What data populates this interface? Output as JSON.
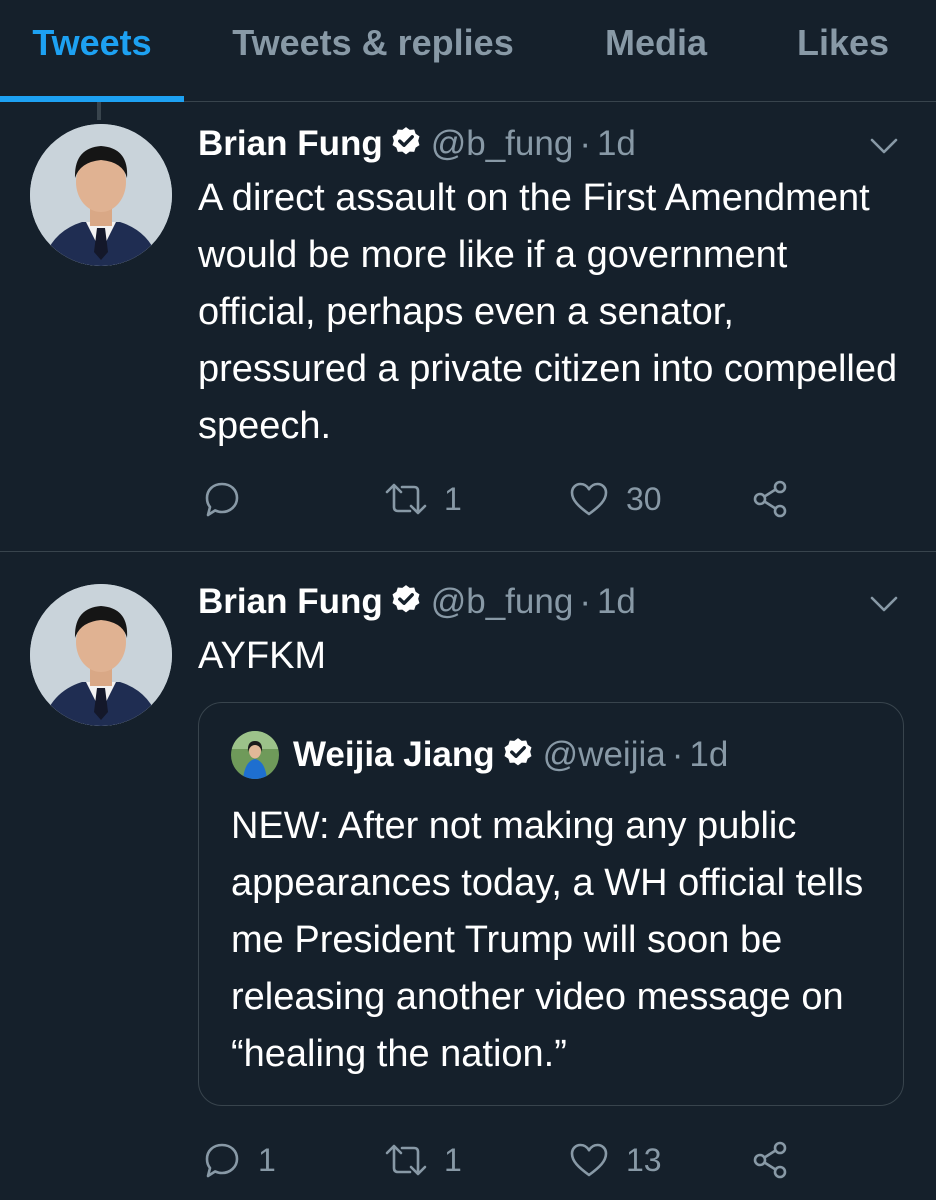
{
  "tabs": [
    {
      "label": "Tweets",
      "active": true
    },
    {
      "label": "Tweets & replies",
      "active": false
    },
    {
      "label": "Media",
      "active": false
    },
    {
      "label": "Likes",
      "active": false
    }
  ],
  "colors": {
    "accent": "#1da1f2",
    "background": "#15202b",
    "secondary_text": "#8899a6",
    "border": "#38444d"
  },
  "tweets": [
    {
      "author_name": "Brian Fung",
      "handle": "@b_fung",
      "separator": "·",
      "time": "1d",
      "verified": true,
      "text": "A direct assault on the First Amendment would be more like if a government official, perhaps even a senator, pressured a private citizen into compelled speech.",
      "reply_count": "",
      "retweet_count": "1",
      "like_count": "30"
    },
    {
      "author_name": "Brian Fung",
      "handle": "@b_fung",
      "separator": "·",
      "time": "1d",
      "verified": true,
      "text": "AYFKM",
      "reply_count": "1",
      "retweet_count": "1",
      "like_count": "13",
      "quoted": {
        "author_name": "Weijia Jiang",
        "handle": "@weijia",
        "separator": "·",
        "time": "1d",
        "verified": true,
        "text": "NEW: After not making any public appearances today, a WH official tells me President Trump will soon be releasing another video message on “healing the nation.”"
      }
    }
  ],
  "icons": {
    "verified": "verified-badge-icon",
    "caret": "chevron-down-icon",
    "reply": "reply-icon",
    "retweet": "retweet-icon",
    "like": "heart-icon",
    "share": "share-icon"
  }
}
